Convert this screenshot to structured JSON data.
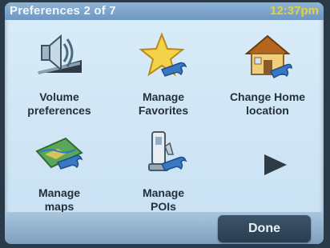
{
  "header": {
    "title": "Preferences 2 of 7",
    "time": "12:37pm"
  },
  "menu": {
    "items": [
      {
        "line1": "Volume",
        "line2": "preferences",
        "icon": "speaker-icon"
      },
      {
        "line1": "Manage",
        "line2": "Favorites",
        "icon": "star-wrench-icon"
      },
      {
        "line1": "Change Home",
        "line2": "location",
        "icon": "house-wrench-icon"
      },
      {
        "line1": "Manage",
        "line2": "maps",
        "icon": "map-wrench-icon"
      },
      {
        "line1": "Manage",
        "line2": "POIs",
        "icon": "poi-wrench-icon"
      }
    ],
    "next_icon": "next-page-arrow-icon"
  },
  "footer": {
    "done_label": "Done"
  },
  "colors": {
    "title_bar": "#7aa3cc",
    "clock": "#e4d23a",
    "background": "#d4e8f6",
    "done_button": "#33495d"
  }
}
